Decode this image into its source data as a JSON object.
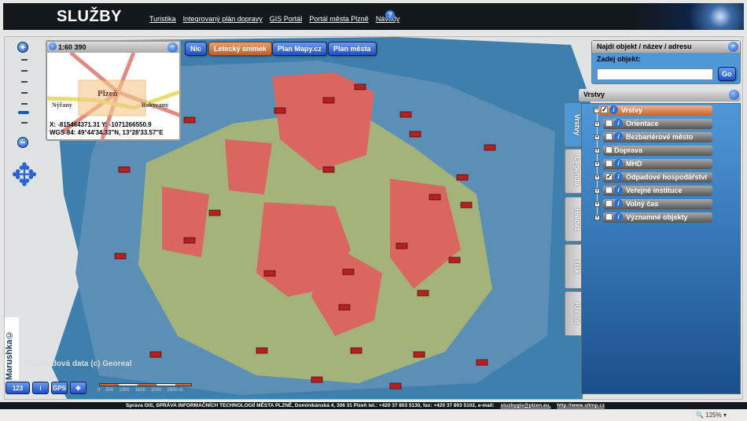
{
  "header": {
    "title": "SLUŽBY",
    "nav": [
      "Turistika",
      "Integrovaný plán dopravy",
      "GIS Portál",
      "Portál města Plzně",
      "Návody"
    ],
    "help_icon": "help-icon"
  },
  "overview": {
    "scale": "1:60 390",
    "labels": {
      "city": "Plzeň",
      "west": "Nýřany",
      "east": "Rokycany"
    },
    "coords": "X: -815464371.31 Y: -1071266550.9",
    "wgs": "WGS-84: 49°44'34.33\"N, 13°28'33.57\"E"
  },
  "basemaps": {
    "items": [
      "Nic",
      "Letecký snímek",
      "Plan Mapy.cz",
      "Plan města"
    ],
    "active": "Letecký snímek"
  },
  "search": {
    "title": "Najdi objekt / název / adresu",
    "label": "Zadej objekt:",
    "value": "",
    "go": "Go"
  },
  "layers": {
    "title": "Vrstvy",
    "tabs": [
      "Vrstvy",
      "Legenda",
      "Hledat",
      "Tisk",
      "Kreslit"
    ],
    "items": [
      {
        "label": "Vrstvy",
        "checked": true
      },
      {
        "label": "Orientace",
        "checked": false
      },
      {
        "label": "Bezbariérové město",
        "checked": false
      },
      {
        "label": "Doprava",
        "checked": false
      },
      {
        "label": "MHD",
        "checked": false
      },
      {
        "label": "Odpadové hospodářství",
        "checked": true
      },
      {
        "label": "Veřejné instituce",
        "checked": false
      },
      {
        "label": "Volný čas",
        "checked": false
      },
      {
        "label": "Významné objekty",
        "checked": false
      }
    ]
  },
  "map": {
    "watermark": "Marushka©",
    "copyright": "Podkladová data (c) Georeal",
    "scale_labels": [
      "0",
      "500",
      "1000",
      "1500",
      "2000",
      "2500 m"
    ],
    "tools": [
      "123",
      "i",
      "GPS",
      "✥"
    ]
  },
  "footer": {
    "text": "Správa GIS, SPRÁVA INFORMAČNÍCH TECHNOLOGIÍ MĚSTA PLZNĚ, Dominikánská 4, 306 31 Plzeň tel.: +420 37 803 5130, fax: +420 37 803 5102, e-mail:",
    "email": "sluzbygis@plzen.eu,",
    "url": "http://www.sitmp.cz"
  },
  "status": {
    "zoom": "125%"
  }
}
